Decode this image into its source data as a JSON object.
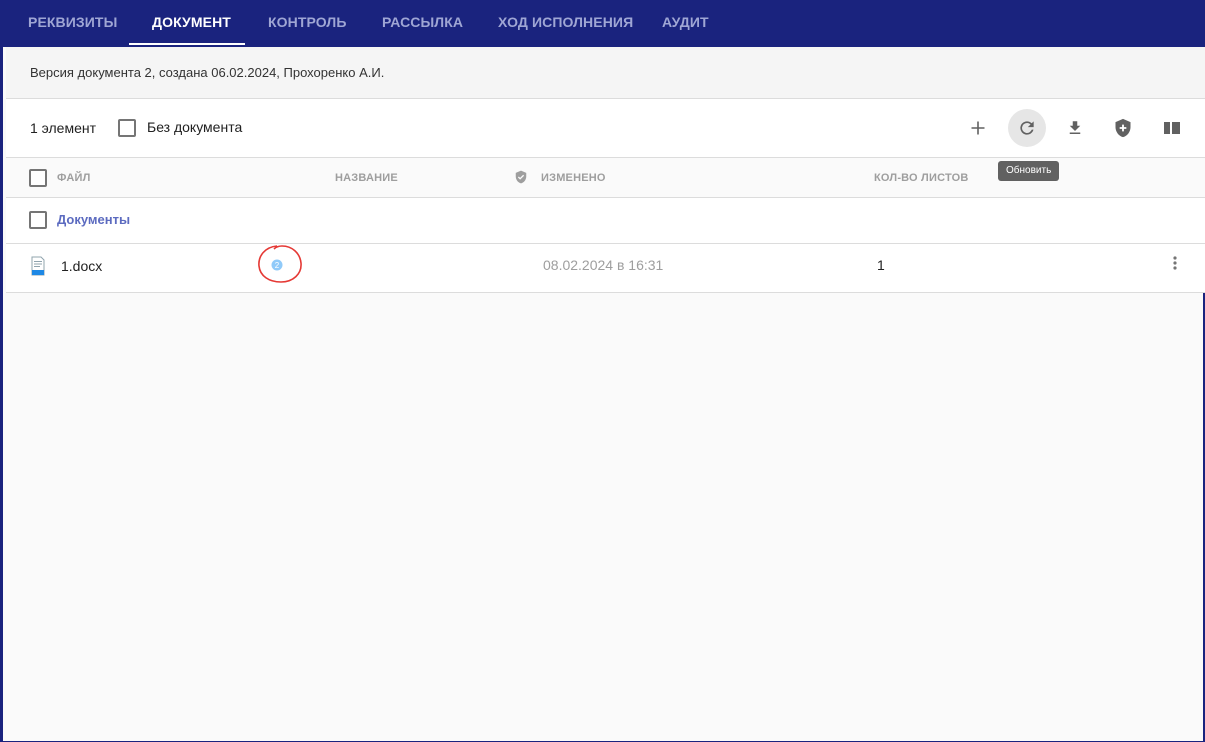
{
  "tabs": [
    {
      "label": "РЕКВИЗИТЫ",
      "active": false
    },
    {
      "label": "ДОКУМЕНТ",
      "active": true
    },
    {
      "label": "КОНТРОЛЬ",
      "active": false
    },
    {
      "label": "РАССЫЛКА",
      "active": false
    },
    {
      "label": "ХОД ИСПОЛНЕНИЯ",
      "active": false
    },
    {
      "label": "АУДИТ",
      "active": false
    }
  ],
  "version_info": "Версия документа 2, создана 06.02.2024, Прохоренко А.И.",
  "toolbar": {
    "count": "1 элемент",
    "no_doc_label": "Без документа",
    "no_doc_checked": false,
    "buttons": [
      {
        "icon": "plus-icon"
      },
      {
        "icon": "refresh-icon",
        "hovered": true
      },
      {
        "icon": "download-icon"
      },
      {
        "icon": "shield-plus-icon"
      },
      {
        "icon": "columns-icon"
      }
    ],
    "tooltip": "Обновить"
  },
  "table": {
    "columns": {
      "file": "ФАЙЛ",
      "name": "НАЗВАНИЕ",
      "shield": "shield-check-icon",
      "modified": "ИЗМЕНЕНО",
      "sheets": "КОЛ-ВО ЛИСТОВ"
    },
    "group": {
      "label": "Документы"
    },
    "rows": [
      {
        "icon": "docx-file-icon",
        "file": "1.docx",
        "version_badge": "2",
        "name": "",
        "modified": "08.02.2024 в 16:31",
        "sheets": "1"
      }
    ]
  },
  "colors": {
    "header_bg": "#1a237e",
    "accent": "#5c6bc0",
    "annotation": "#e53935"
  }
}
